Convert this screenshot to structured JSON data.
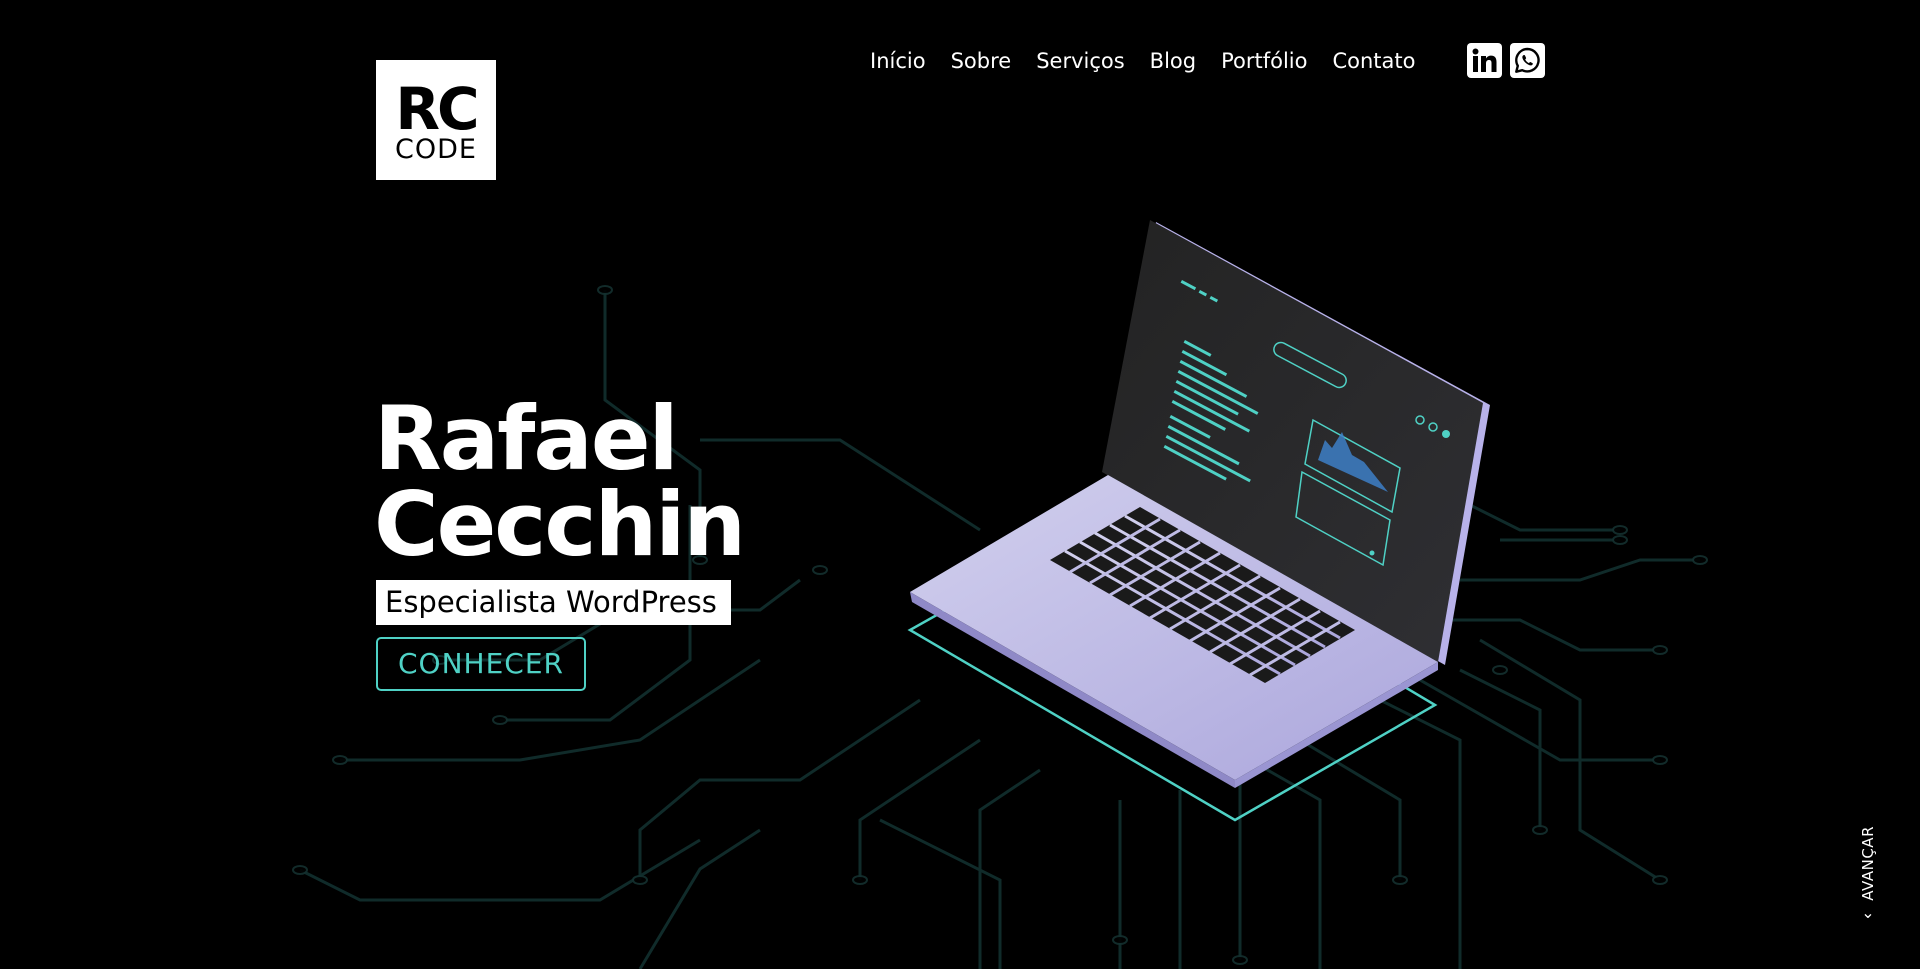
{
  "logo": {
    "line1": "RC",
    "line2": "CODE"
  },
  "nav": {
    "items": [
      {
        "label": "Início"
      },
      {
        "label": "Sobre"
      },
      {
        "label": "Serviços"
      },
      {
        "label": "Blog"
      },
      {
        "label": "Portfólio"
      },
      {
        "label": "Contato"
      }
    ]
  },
  "social": {
    "linkedin_icon": "linkedin-icon",
    "whatsapp_icon": "whatsapp-icon"
  },
  "hero": {
    "title_line1": "Rafael",
    "title_line2": "Cecchin",
    "subtitle": "Especialista WordPress",
    "cta_label": "CONHECER"
  },
  "scroll": {
    "label": "AVANÇAR",
    "icon": "chevron-down-icon"
  },
  "colors": {
    "background": "#000000",
    "accent": "#4fd1c5",
    "laptop_body": "#bdb8e6",
    "text": "#ffffff"
  }
}
